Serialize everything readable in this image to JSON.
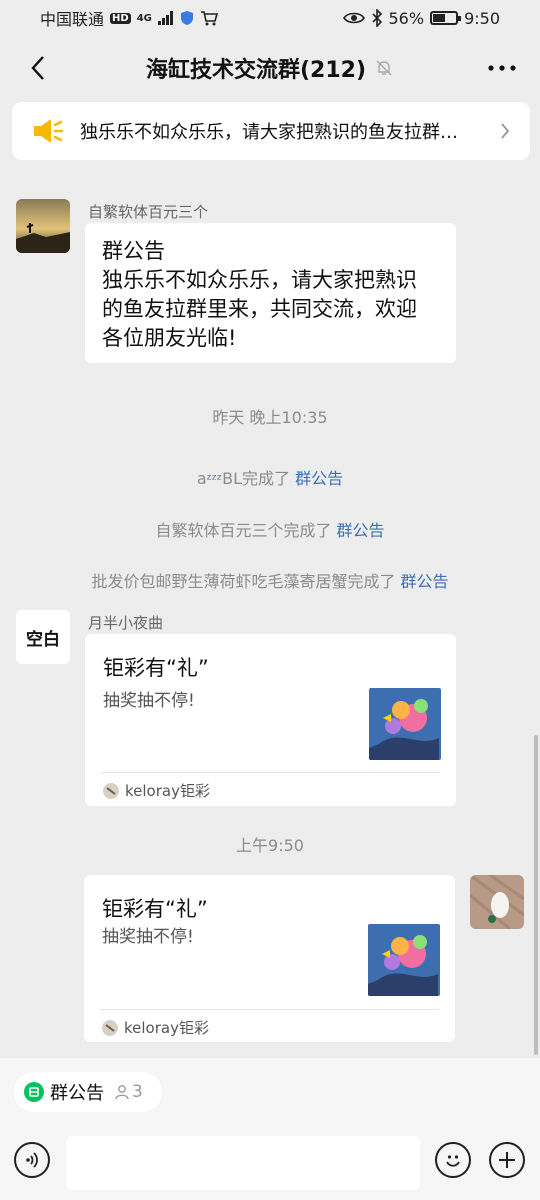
{
  "status_bar": {
    "carrier": "中国联通",
    "hd": "HD",
    "network": "4G",
    "battery": "56%",
    "battery_level": 0.56,
    "time": "9:50"
  },
  "header": {
    "title": "海缸技术交流群(212)"
  },
  "notice_banner": {
    "text": "独乐乐不如众乐乐，请大家把熟识的鱼友拉群…"
  },
  "messages": {
    "first": {
      "sender": "自繁软体百元三个",
      "lines": [
        "群公告",
        "独乐乐不如众乐乐，请大家把熟识",
        "的鱼友拉群里来，共同交流，欢迎",
        "各位朋友光临!"
      ]
    },
    "time1": "昨天 晚上10:35",
    "system": [
      {
        "prefix": "a",
        "emoji": "ᶻᶻᶻ",
        "name_suffix": "BL",
        "done": "完成了 ",
        "link": "群公告"
      },
      {
        "name": "自繁软体百元三个",
        "done": "完成了 ",
        "link": "群公告"
      },
      {
        "name": "批发价包邮野生薄荷虾吃毛藻寄居蟹",
        "done": "完成了 ",
        "link": "群公告"
      }
    ],
    "second": {
      "sender": "月半小夜曲",
      "avatar_text": "空白",
      "card_title": "钜彩有“礼”",
      "card_sub": "抽奖抽不停!",
      "card_footer": "keloray钜彩"
    },
    "time2": "上午9:50",
    "third": {
      "card_title": "钜彩有“礼”",
      "card_sub": "抽奖抽不停!",
      "card_footer": "keloray钜彩"
    }
  },
  "bottom": {
    "chip_label": "群公告",
    "chip_count": "3"
  },
  "colors": {
    "background": "#ededed",
    "link": "#3e6fb8",
    "accent_green": "#07c160",
    "speaker_yellow": "#f5b900"
  }
}
